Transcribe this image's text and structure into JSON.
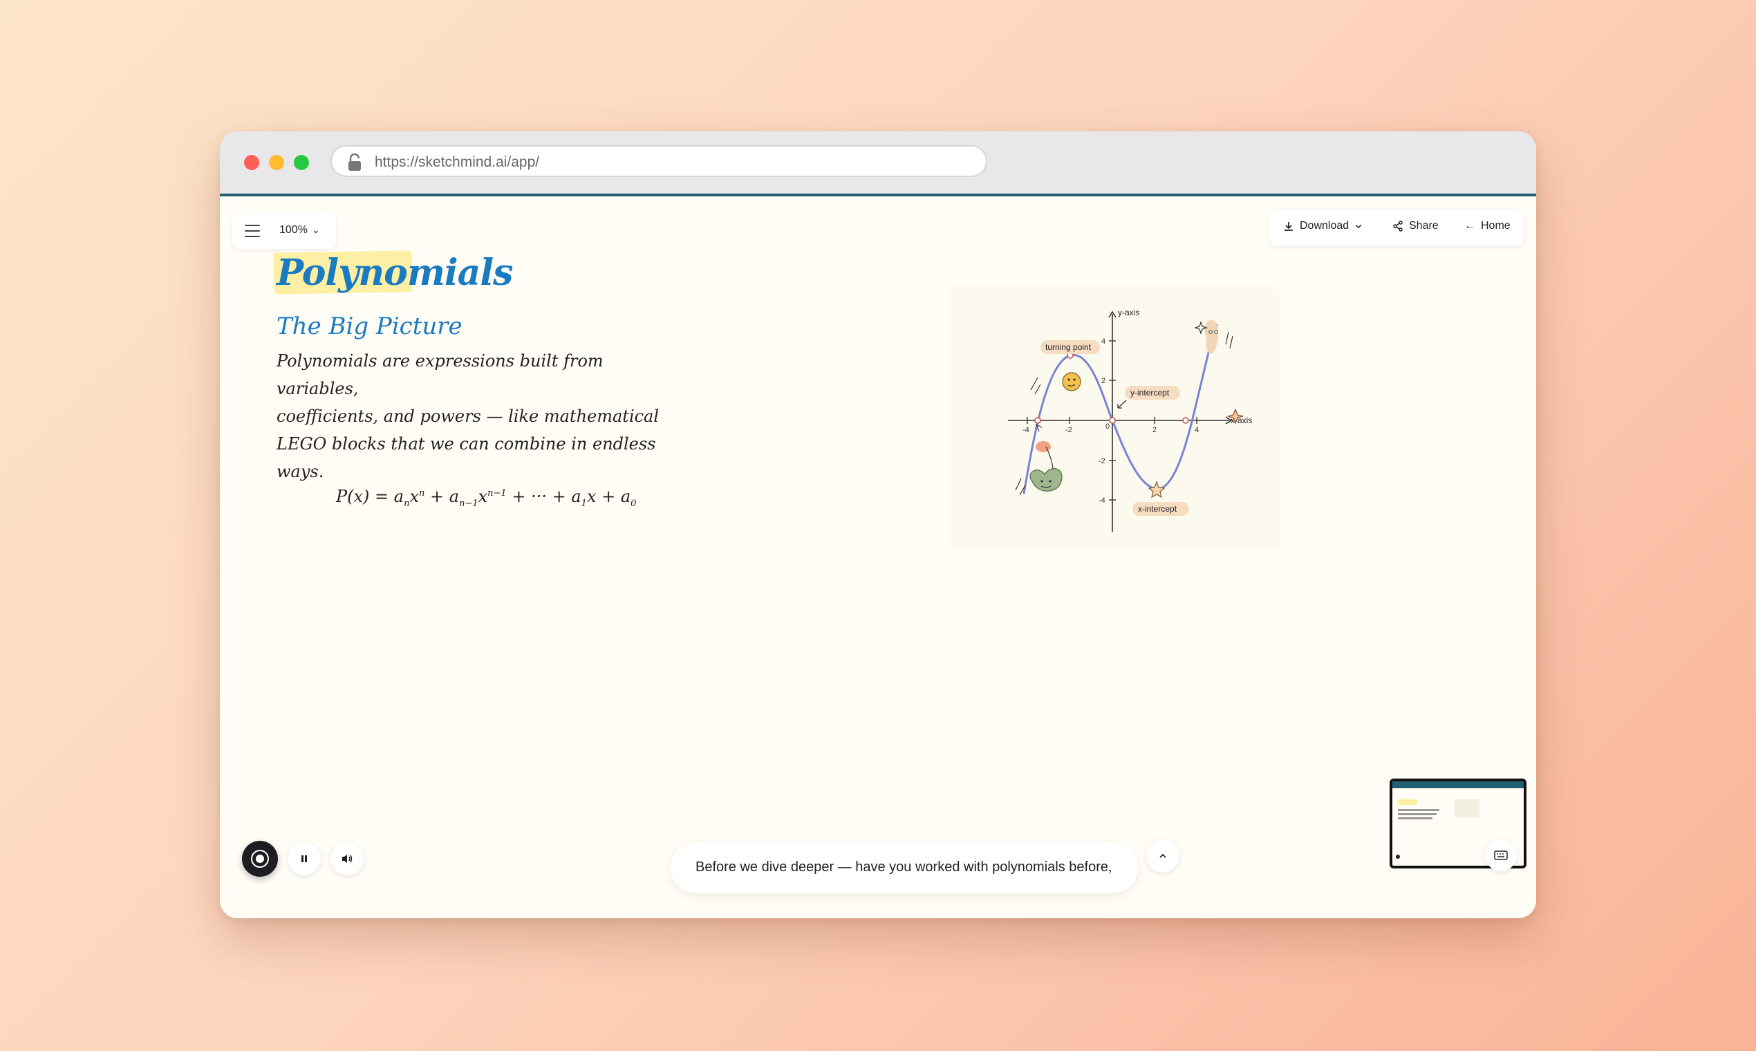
{
  "browser": {
    "url": "https://sketchmind.ai/app/"
  },
  "toolbar": {
    "zoom": "100%",
    "download_label": "Download",
    "share_label": "Share",
    "home_label": "Home"
  },
  "lesson": {
    "title": "Polynomials",
    "subtitle": "The Big Picture",
    "paragraph_lines": [
      "Polynomials are expressions built from variables,",
      "coefficients, and powers — like mathematical",
      "LEGO blocks that we can combine in endless",
      "ways."
    ],
    "formula": {
      "lhs": "P(x) = a",
      "t1_sub": "n",
      "t1_x": "x",
      "t1_sup": "n",
      "plus1": " + a",
      "t2_sub": "n−1",
      "t2_x": "x",
      "t2_sup": "n−1",
      "dots": " + ··· + a",
      "t3_sub": "1",
      "t3_x": "x + a",
      "t4_sub": "0"
    }
  },
  "graph": {
    "x_axis_label": "x-axis",
    "y_axis_label": "y-axis",
    "x_ticks": [
      "-4",
      "-2",
      "0",
      "2",
      "4"
    ],
    "y_ticks": [
      "4",
      "2",
      "-2",
      "-4"
    ],
    "annotations": {
      "turning_point": "turning point",
      "y_intercept": "y-intercept",
      "x_intercept": "x-intercept"
    }
  },
  "caption": {
    "text": "Before we dive deeper — have you worked with polynomials before,"
  }
}
